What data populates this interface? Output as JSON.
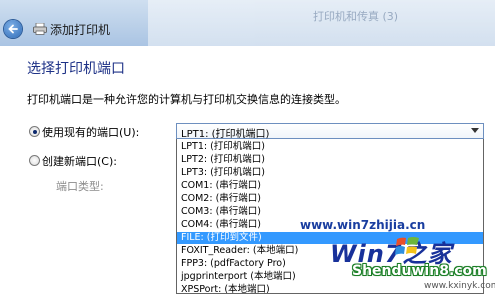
{
  "window": {
    "title": "添加打印机",
    "background_window_title": "打印机和传真 (3)"
  },
  "page": {
    "heading": "选择打印机端口",
    "description": "打印机端口是一种允许您的计算机与打印机交换信息的连接类型。"
  },
  "options": {
    "use_existing": {
      "label": "使用现有的端口(U):",
      "selected": true
    },
    "create_new": {
      "label": "创建新端口(C):",
      "selected": false
    },
    "port_type_label": "端口类型:"
  },
  "port_combo": {
    "value": "LPT1: (打印机端口)",
    "items": [
      "LPT1: (打印机端口)",
      "LPT2: (打印机端口)",
      "LPT3: (打印机端口)",
      "COM1: (串行端口)",
      "COM2: (串行端口)",
      "COM3: (串行端口)",
      "COM4: (串行端口)",
      "FILE: (打印到文件)",
      "FOXIT_Reader: (本地端口)",
      "FPP3: (pdfFactory Pro)",
      "jpgprinterport (本地端口)",
      "XPSPort: (本地端口)"
    ],
    "highlighted_index": 7
  },
  "watermarks": {
    "url1": "www.win7zhijia.cn",
    "logo": "Win7之家",
    "url2": "Shenduwin8.com",
    "url3": "www.kxinyk.com"
  },
  "colors": {
    "heading": "#1e3287",
    "selection": "#3399ff"
  }
}
